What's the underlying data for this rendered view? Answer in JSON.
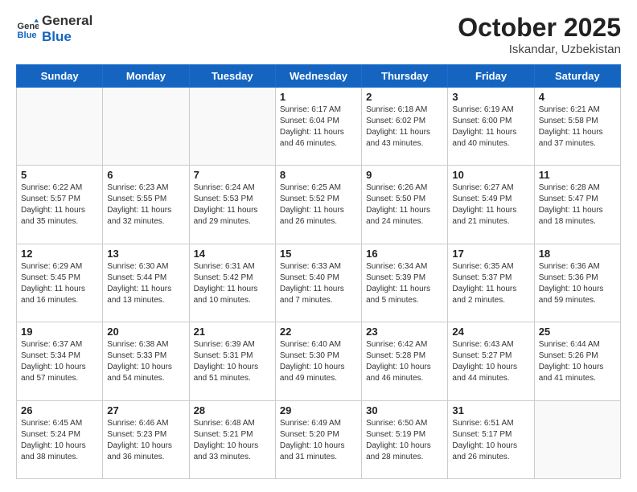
{
  "header": {
    "logo_general": "General",
    "logo_blue": "Blue",
    "title": "October 2025",
    "subtitle": "Iskandar, Uzbekistan"
  },
  "weekdays": [
    "Sunday",
    "Monday",
    "Tuesday",
    "Wednesday",
    "Thursday",
    "Friday",
    "Saturday"
  ],
  "weeks": [
    [
      {
        "day": "",
        "info": ""
      },
      {
        "day": "",
        "info": ""
      },
      {
        "day": "",
        "info": ""
      },
      {
        "day": "1",
        "info": "Sunrise: 6:17 AM\nSunset: 6:04 PM\nDaylight: 11 hours\nand 46 minutes."
      },
      {
        "day": "2",
        "info": "Sunrise: 6:18 AM\nSunset: 6:02 PM\nDaylight: 11 hours\nand 43 minutes."
      },
      {
        "day": "3",
        "info": "Sunrise: 6:19 AM\nSunset: 6:00 PM\nDaylight: 11 hours\nand 40 minutes."
      },
      {
        "day": "4",
        "info": "Sunrise: 6:21 AM\nSunset: 5:58 PM\nDaylight: 11 hours\nand 37 minutes."
      }
    ],
    [
      {
        "day": "5",
        "info": "Sunrise: 6:22 AM\nSunset: 5:57 PM\nDaylight: 11 hours\nand 35 minutes."
      },
      {
        "day": "6",
        "info": "Sunrise: 6:23 AM\nSunset: 5:55 PM\nDaylight: 11 hours\nand 32 minutes."
      },
      {
        "day": "7",
        "info": "Sunrise: 6:24 AM\nSunset: 5:53 PM\nDaylight: 11 hours\nand 29 minutes."
      },
      {
        "day": "8",
        "info": "Sunrise: 6:25 AM\nSunset: 5:52 PM\nDaylight: 11 hours\nand 26 minutes."
      },
      {
        "day": "9",
        "info": "Sunrise: 6:26 AM\nSunset: 5:50 PM\nDaylight: 11 hours\nand 24 minutes."
      },
      {
        "day": "10",
        "info": "Sunrise: 6:27 AM\nSunset: 5:49 PM\nDaylight: 11 hours\nand 21 minutes."
      },
      {
        "day": "11",
        "info": "Sunrise: 6:28 AM\nSunset: 5:47 PM\nDaylight: 11 hours\nand 18 minutes."
      }
    ],
    [
      {
        "day": "12",
        "info": "Sunrise: 6:29 AM\nSunset: 5:45 PM\nDaylight: 11 hours\nand 16 minutes."
      },
      {
        "day": "13",
        "info": "Sunrise: 6:30 AM\nSunset: 5:44 PM\nDaylight: 11 hours\nand 13 minutes."
      },
      {
        "day": "14",
        "info": "Sunrise: 6:31 AM\nSunset: 5:42 PM\nDaylight: 11 hours\nand 10 minutes."
      },
      {
        "day": "15",
        "info": "Sunrise: 6:33 AM\nSunset: 5:40 PM\nDaylight: 11 hours\nand 7 minutes."
      },
      {
        "day": "16",
        "info": "Sunrise: 6:34 AM\nSunset: 5:39 PM\nDaylight: 11 hours\nand 5 minutes."
      },
      {
        "day": "17",
        "info": "Sunrise: 6:35 AM\nSunset: 5:37 PM\nDaylight: 11 hours\nand 2 minutes."
      },
      {
        "day": "18",
        "info": "Sunrise: 6:36 AM\nSunset: 5:36 PM\nDaylight: 10 hours\nand 59 minutes."
      }
    ],
    [
      {
        "day": "19",
        "info": "Sunrise: 6:37 AM\nSunset: 5:34 PM\nDaylight: 10 hours\nand 57 minutes."
      },
      {
        "day": "20",
        "info": "Sunrise: 6:38 AM\nSunset: 5:33 PM\nDaylight: 10 hours\nand 54 minutes."
      },
      {
        "day": "21",
        "info": "Sunrise: 6:39 AM\nSunset: 5:31 PM\nDaylight: 10 hours\nand 51 minutes."
      },
      {
        "day": "22",
        "info": "Sunrise: 6:40 AM\nSunset: 5:30 PM\nDaylight: 10 hours\nand 49 minutes."
      },
      {
        "day": "23",
        "info": "Sunrise: 6:42 AM\nSunset: 5:28 PM\nDaylight: 10 hours\nand 46 minutes."
      },
      {
        "day": "24",
        "info": "Sunrise: 6:43 AM\nSunset: 5:27 PM\nDaylight: 10 hours\nand 44 minutes."
      },
      {
        "day": "25",
        "info": "Sunrise: 6:44 AM\nSunset: 5:26 PM\nDaylight: 10 hours\nand 41 minutes."
      }
    ],
    [
      {
        "day": "26",
        "info": "Sunrise: 6:45 AM\nSunset: 5:24 PM\nDaylight: 10 hours\nand 38 minutes."
      },
      {
        "day": "27",
        "info": "Sunrise: 6:46 AM\nSunset: 5:23 PM\nDaylight: 10 hours\nand 36 minutes."
      },
      {
        "day": "28",
        "info": "Sunrise: 6:48 AM\nSunset: 5:21 PM\nDaylight: 10 hours\nand 33 minutes."
      },
      {
        "day": "29",
        "info": "Sunrise: 6:49 AM\nSunset: 5:20 PM\nDaylight: 10 hours\nand 31 minutes."
      },
      {
        "day": "30",
        "info": "Sunrise: 6:50 AM\nSunset: 5:19 PM\nDaylight: 10 hours\nand 28 minutes."
      },
      {
        "day": "31",
        "info": "Sunrise: 6:51 AM\nSunset: 5:17 PM\nDaylight: 10 hours\nand 26 minutes."
      },
      {
        "day": "",
        "info": ""
      }
    ]
  ]
}
